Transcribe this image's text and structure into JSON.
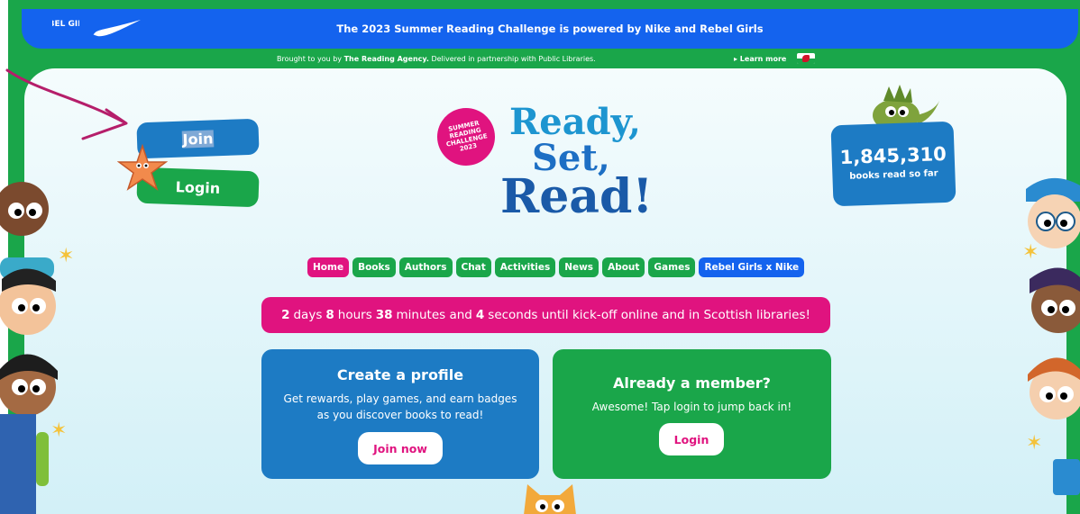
{
  "topbar": {
    "sponsor_text": "The 2023 Summer Reading Challenge is powered by Nike and Rebel Girls",
    "rebel_logo": "REBEL GIRLS"
  },
  "subbar": {
    "credit_prefix": "Brought to you by ",
    "credit_org": "The Reading Agency.",
    "credit_suffix": " Delivered in partnership with Public Libraries.",
    "learn_more": "▸ Learn more"
  },
  "auth": {
    "join_label": "Join",
    "login_label": "Login"
  },
  "logo": {
    "badge_lines": [
      "SUMMER",
      "READING",
      "CHALLENGE",
      "2023"
    ],
    "ready": "Ready,",
    "set": "Set,",
    "read": "Read!"
  },
  "counter": {
    "value": "1,845,310",
    "label": "books read so far"
  },
  "nav": {
    "items": [
      "Home",
      "Books",
      "Authors",
      "Chat",
      "Activities",
      "News",
      "About",
      "Games",
      "Rebel Girls x Nike"
    ]
  },
  "countdown": {
    "days": "2",
    "days_unit": "days",
    "hours": "8",
    "hours_unit": "hours",
    "minutes": "38",
    "minutes_unit": "minutes and",
    "seconds": "4",
    "seconds_unit": "seconds until kick-off online and in Scottish libraries!"
  },
  "profile_card": {
    "title": "Create a profile",
    "text": "Get rewards, play games, and earn badges as you discover books to read!",
    "cta": "Join now"
  },
  "member_card": {
    "title": "Already a member?",
    "text": "Awesome! Tap login to jump back in!",
    "cta": "Login"
  },
  "colors": {
    "green": "#1aa64a",
    "blue_bar": "#1463ee",
    "pink": "#e0137f",
    "mid_blue": "#1d7bc4"
  }
}
